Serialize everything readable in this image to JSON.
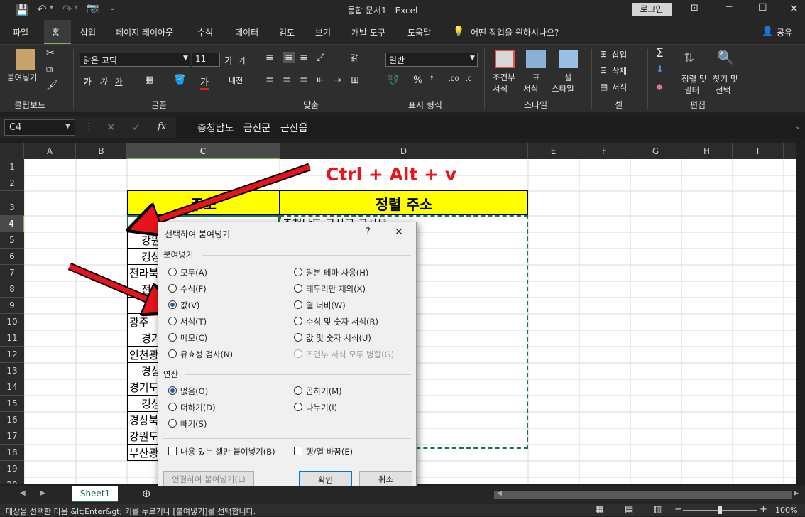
{
  "titlebar": {
    "title": "통합 문서1  -  Excel",
    "login_label": "로그인"
  },
  "ribbon_tabs": [
    "파일",
    "홈",
    "삽입",
    "페이지 레이아웃",
    "수식",
    "데이터",
    "검토",
    "보기",
    "개발 도구",
    "도움말"
  ],
  "tell_me": "어떤 작업을 원하시나요?",
  "share_label": "공유",
  "ribbon": {
    "paste_label": "붙여넣기",
    "font_name": "맑은 고딕",
    "font_size": "11",
    "number_format": "일반",
    "wrap_label": "내어쓰기",
    "conditional_label_1": "조건부",
    "conditional_label_2": "서식",
    "table_label_1": "표",
    "table_label_2": "서식",
    "cellstyle_label_1": "셀",
    "cellstyle_label_2": "스타일",
    "insert_label": "삽입",
    "delete_label": "삭제",
    "format_label": "서식",
    "sort_label_1": "정렬 및",
    "sort_label_2": "필터",
    "find_label_1": "찾기 및",
    "find_label_2": "선택",
    "groups": [
      "클립보드",
      "글꼴",
      "맞춤",
      "표시 형식",
      "스타일",
      "셀",
      "편집"
    ]
  },
  "formula_bar": {
    "name_box": "C4",
    "fx": "fx",
    "content": "충청남도   금산군   근산읍"
  },
  "columns": [
    "A",
    "B",
    "C",
    "D",
    "E",
    "F",
    "G",
    "H",
    "I"
  ],
  "rows": [
    "1",
    "2",
    "3",
    "4",
    "5",
    "6",
    "7",
    "8",
    "9",
    "10",
    "11",
    "12",
    "13",
    "14",
    "15",
    "16",
    "17",
    "18",
    "19",
    "20"
  ],
  "sheet": {
    "header_c": "주소",
    "header_d": "정렬 주소",
    "c_values": [
      "",
      "강원도",
      "경상",
      "전라북",
      "전라남",
      "",
      "광주",
      "경기도",
      "인천광",
      "경상",
      "경기도",
      "경상북",
      "경상북",
      "강원도",
      "부산광"
    ],
    "d4_value": "충청남도 금산군 근산읍"
  },
  "annotation": {
    "shortcut": "Ctrl + Alt + v",
    "color": "#e8141b"
  },
  "dialog": {
    "title": "선택하여 붙여넣기",
    "help": "?",
    "close": "✕",
    "section_paste": "붙여넣기",
    "paste_left": [
      "모두(A)",
      "수식(F)",
      "값(V)",
      "서식(T)",
      "메모(C)",
      "유효성 검사(N)"
    ],
    "paste_right": [
      "원본 테마 사용(H)",
      "테두리만 제외(X)",
      "열 너비(W)",
      "수식 및 숫자 서식(R)",
      "값 및 숫자 서식(U)",
      "조건부 서식 모두 병합(G)"
    ],
    "section_op": "연산",
    "op_left": [
      "없음(O)",
      "더하기(D)",
      "빼기(S)"
    ],
    "op_right": [
      "곱하기(M)",
      "나누기(I)"
    ],
    "skip_blanks": "내용 있는 셀만 붙여넣기(B)",
    "transpose": "행/열 바꿈(E)",
    "paste_link": "연결하여 붙여넣기(L)",
    "ok": "확인",
    "cancel": "취소"
  },
  "sheet_tab": "Sheet1",
  "status": {
    "message": "대상을 선택한 다음 &lt;Enter&gt; 키를 누르거나 [붙여넣기]를 선택합니다.",
    "zoom": "100%"
  }
}
